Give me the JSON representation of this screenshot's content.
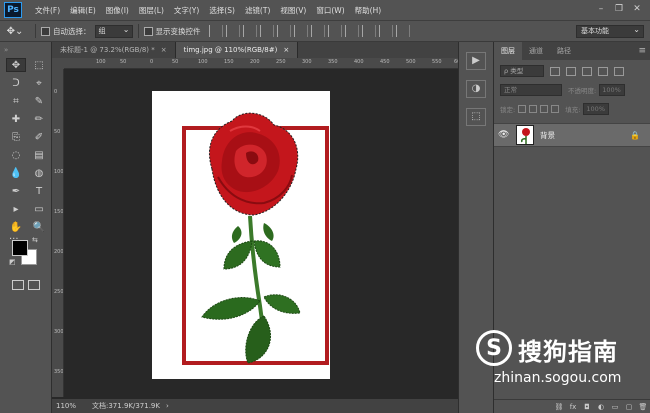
{
  "app": {
    "logo": "Ps"
  },
  "menu": [
    "文件(F)",
    "编辑(E)",
    "图像(I)",
    "图层(L)",
    "文字(Y)",
    "选择(S)",
    "滤镜(T)",
    "视图(V)",
    "窗口(W)",
    "帮助(H)"
  ],
  "window_controls": [
    "–",
    "❐",
    "✕"
  ],
  "options": {
    "auto_select_label": "自动选择：",
    "auto_select_value": "组",
    "show_transform_label": "显示变换控件",
    "workspace": "基本功能"
  },
  "tabs": [
    {
      "label": "未标题-1 @ 73.2%(RGB/8) *",
      "close": "×"
    },
    {
      "label": "timg.jpg @ 110%(RGB/8#)",
      "close": "×"
    }
  ],
  "ruler": {
    "h_ticks": [
      "100",
      "50",
      "0",
      "50",
      "100",
      "150",
      "200",
      "250",
      "300",
      "350",
      "400",
      "450",
      "500",
      "550",
      "600"
    ],
    "v_ticks": [
      "0",
      "50",
      "100",
      "150",
      "200",
      "250",
      "300",
      "350"
    ]
  },
  "status": {
    "zoom": "110%",
    "doc_size": "文档:371.9K/371.9K",
    "arrow": "›"
  },
  "layers_panel": {
    "tabs": [
      "图层",
      "通道",
      "路径"
    ],
    "filter_placeholder": "ρ 类型",
    "blend_mode": "正常",
    "opacity_label": "不透明度:",
    "opacity_value": "100%",
    "lock_label": "锁定:",
    "fill_label": "填充:",
    "fill_value": "100%",
    "layer": {
      "name": "背景",
      "lock": "🔒"
    },
    "menu_icon": "≡",
    "footer_icons": [
      "⛓",
      "fx",
      "◘",
      "◐",
      "▭",
      "▢",
      "🗑"
    ]
  },
  "tools": {
    "items": [
      "✥",
      "⬚",
      "ᑐ",
      "⌖",
      "⌗",
      "✎",
      "✚",
      "✏",
      "⎘",
      "✐",
      "◌",
      "▤",
      "💧",
      "◍",
      "✒",
      "T",
      "▸",
      "▭",
      "✋",
      "🔍"
    ],
    "dots": "···",
    "swap": "⇆",
    "default": "◩"
  },
  "strip_icons": [
    "▶",
    "◑",
    "⬚"
  ],
  "watermark": {
    "logo_letter": "S",
    "title": "搜狗指南",
    "domain": "zhinan.sogou.com"
  }
}
